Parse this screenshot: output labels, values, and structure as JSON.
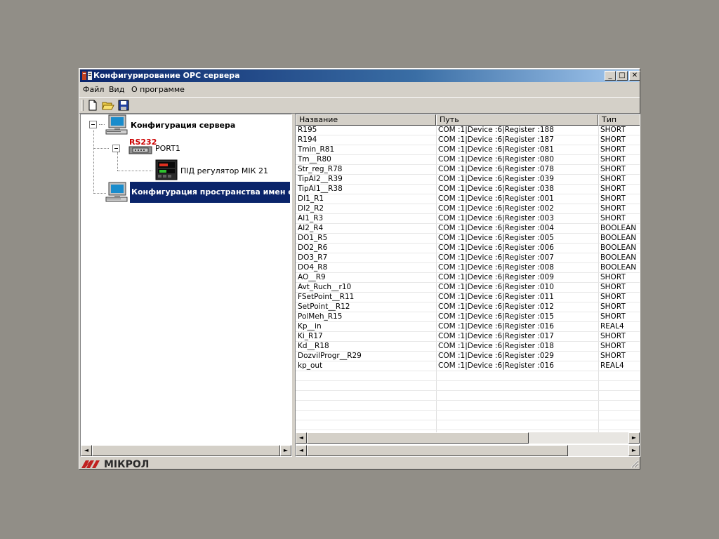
{
  "window": {
    "title": "Конфигурирование ОРС сервера",
    "minimize_glyph": "_",
    "maximize_glyph": "□",
    "close_glyph": "✕"
  },
  "menu": {
    "items": [
      "Файл",
      "Вид",
      "О программе"
    ]
  },
  "toolbar": {
    "buttons": [
      "new-file-icon",
      "open-folder-icon",
      "save-disk-icon"
    ]
  },
  "tree": {
    "root": "Конфигурация сервера",
    "port_tag": "RS232",
    "port": "PORT1",
    "device": "ПІД регулятор МІК 21",
    "namespace": "Конфигурация пространства имен серв"
  },
  "table": {
    "columns": [
      "Название",
      "Путь",
      "Тип"
    ],
    "rows": [
      [
        "R195",
        "COM :1|Device :6|Register :188",
        "SHORT"
      ],
      [
        "R194",
        "COM :1|Device :6|Register :187",
        "SHORT"
      ],
      [
        "Tmin_R81",
        "COM :1|Device :6|Register :081",
        "SHORT"
      ],
      [
        "Tm__R80",
        "COM :1|Device :6|Register :080",
        "SHORT"
      ],
      [
        "Str_reg_R78",
        "COM :1|Device :6|Register :078",
        "SHORT"
      ],
      [
        "TipAI2__R39",
        "COM :1|Device :6|Register :039",
        "SHORT"
      ],
      [
        "TipAI1__R38",
        "COM :1|Device :6|Register :038",
        "SHORT"
      ],
      [
        "DI1_R1",
        "COM :1|Device :6|Register :001",
        "SHORT"
      ],
      [
        "DI2_R2",
        "COM :1|Device :6|Register :002",
        "SHORT"
      ],
      [
        "AI1_R3",
        "COM :1|Device :6|Register :003",
        "SHORT"
      ],
      [
        "AI2_R4",
        "COM :1|Device :6|Register :004",
        "BOOLEAN"
      ],
      [
        "DO1_R5",
        "COM :1|Device :6|Register :005",
        "BOOLEAN"
      ],
      [
        "DO2_R6",
        "COM :1|Device :6|Register :006",
        "BOOLEAN"
      ],
      [
        "DO3_R7",
        "COM :1|Device :6|Register :007",
        "BOOLEAN"
      ],
      [
        "DO4_R8",
        "COM :1|Device :6|Register :008",
        "BOOLEAN"
      ],
      [
        "AO__R9",
        "COM :1|Device :6|Register :009",
        "SHORT"
      ],
      [
        "Avt_Ruch__r10",
        "COM :1|Device :6|Register :010",
        "SHORT"
      ],
      [
        "FSetPoint__R11",
        "COM :1|Device :6|Register :011",
        "SHORT"
      ],
      [
        "SetPoint__R12",
        "COM :1|Device :6|Register :012",
        "SHORT"
      ],
      [
        "PolMeh_R15",
        "COM :1|Device :6|Register :015",
        "SHORT"
      ],
      [
        "Kp__in",
        "COM :1|Device :6|Register :016",
        "REAL4"
      ],
      [
        "Ki_R17",
        "COM :1|Device :6|Register :017",
        "SHORT"
      ],
      [
        "Kd__R18",
        "COM :1|Device :6|Register :018",
        "SHORT"
      ],
      [
        "DozvilProgr__R29",
        "COM :1|Device :6|Register :029",
        "SHORT"
      ],
      [
        "kp_out",
        "COM :1|Device :6|Register :016",
        "REAL4"
      ]
    ]
  },
  "scrollbar": {
    "left_arrow": "◄",
    "right_arrow": "►"
  },
  "status": {
    "logo_text": "МІКРОЛ"
  },
  "colors": {
    "selection": "#0a246a",
    "rs232_tag": "#cc0000"
  }
}
